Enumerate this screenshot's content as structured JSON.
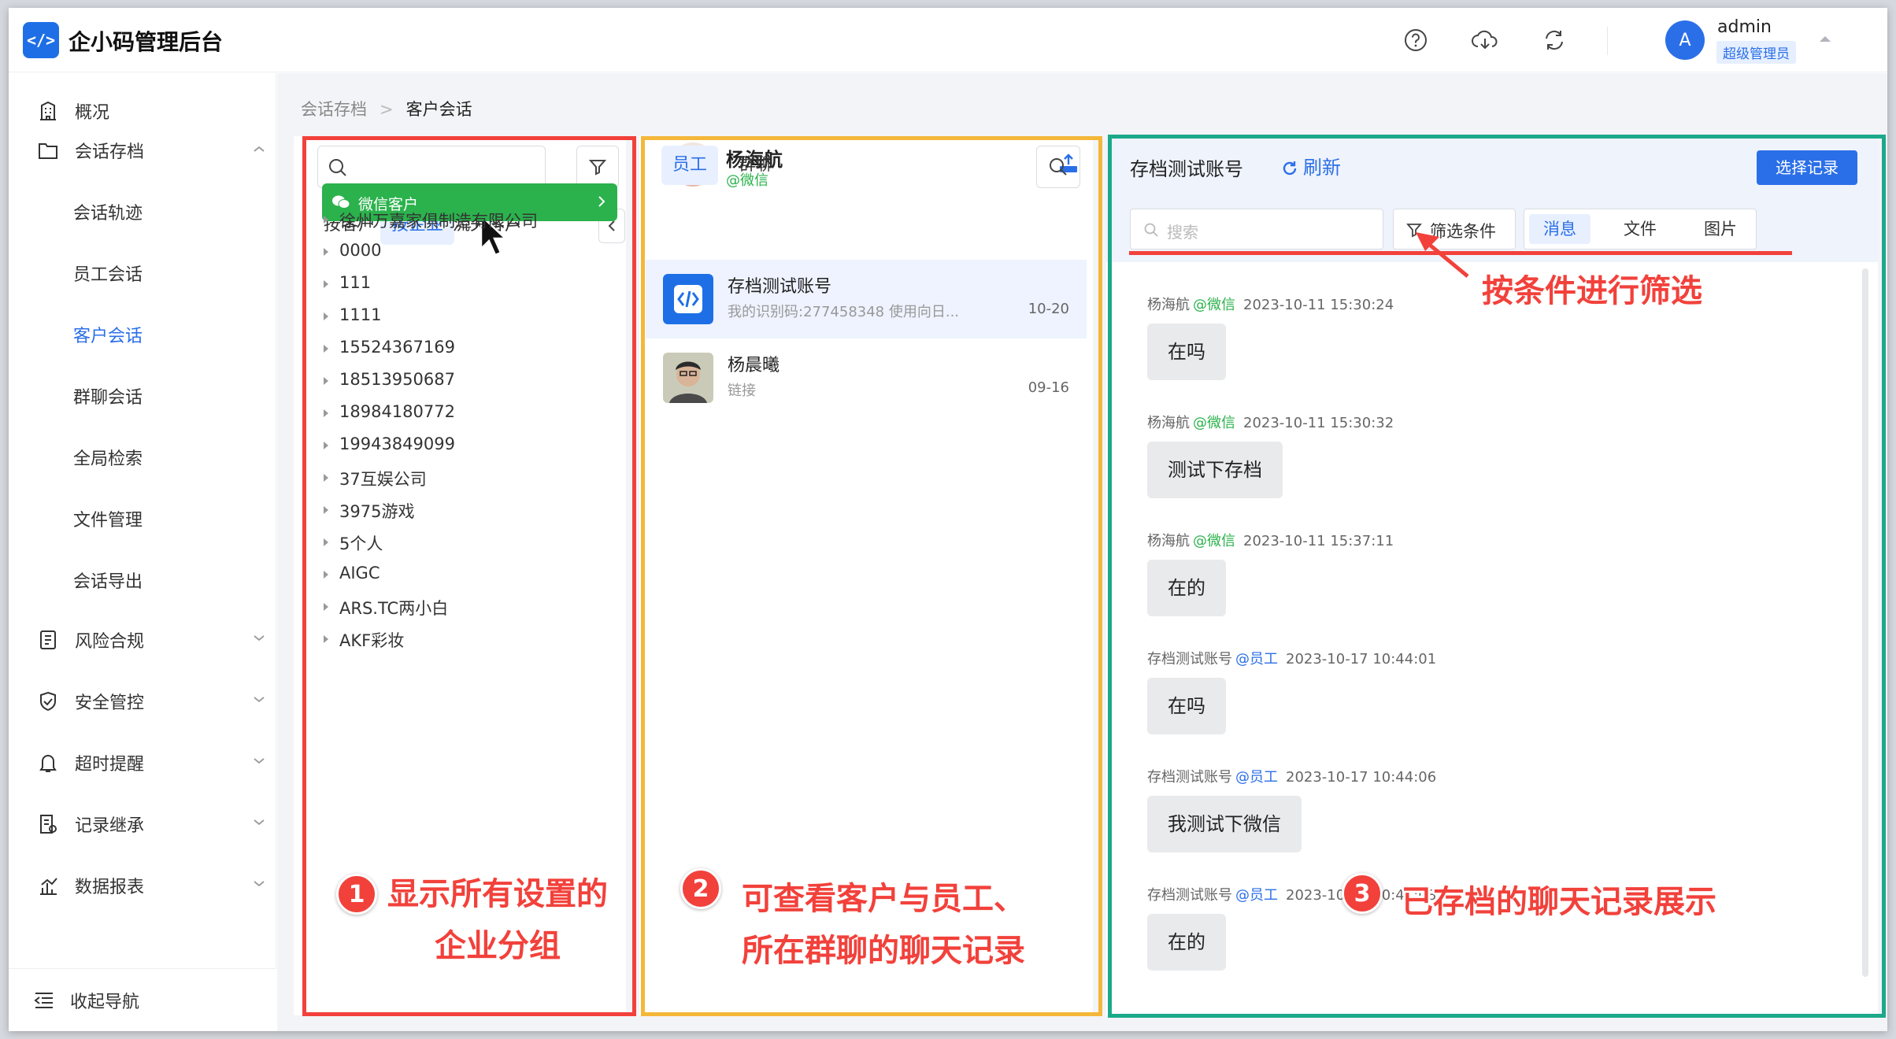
{
  "header": {
    "logo_text": "</>",
    "app_title": "企小码管理后台",
    "user_initial": "A",
    "user_name": "admin",
    "user_role": "超级管理员"
  },
  "sidebar": {
    "items": [
      {
        "label": "概况",
        "icon": "building-icon"
      },
      {
        "label": "会话存档",
        "icon": "folder-icon",
        "expanded": true
      },
      {
        "label": "会话轨迹"
      },
      {
        "label": "员工会话"
      },
      {
        "label": "客户会话",
        "active": true
      },
      {
        "label": "群聊会话"
      },
      {
        "label": "全局检索"
      },
      {
        "label": "文件管理"
      },
      {
        "label": "会话导出"
      },
      {
        "label": "风险合规",
        "icon": "clipboard-icon"
      },
      {
        "label": "安全管控",
        "icon": "shield-check-icon"
      },
      {
        "label": "超时提醒",
        "icon": "bell-icon"
      },
      {
        "label": "记录继承",
        "icon": "record-icon"
      },
      {
        "label": "数据报表",
        "icon": "chart-icon"
      }
    ],
    "collapse_label": "收起导航"
  },
  "breadcrumb": {
    "parent": "会话存档",
    "current": "客户会话"
  },
  "panel1": {
    "tabs": [
      "按客户",
      "按企业",
      "流失客户"
    ],
    "active_tab": "按企业",
    "group_header": "微信客户",
    "groups": [
      "徐州万嘉家俱制造有限公司",
      "0000",
      "111",
      "1111",
      "15524367169",
      "18513950687",
      "18984180772",
      "19943849099",
      "37互娱公司",
      "3975游戏",
      "5个人",
      "AIGC",
      "ARS.TC两小白",
      "AKF彩妆"
    ]
  },
  "panel2": {
    "contact_name": "杨海航",
    "contact_source": "@微信",
    "tabs": [
      "员工",
      "群聊"
    ],
    "active_tab": "员工",
    "conversations": [
      {
        "name": "存档测试账号",
        "preview": "我的识别码:277458348 使用向日...",
        "date": "10-20"
      },
      {
        "name": "杨晨曦",
        "preview": "链接",
        "date": "09-16"
      }
    ]
  },
  "panel3": {
    "title": "存档测试账号",
    "refresh_label": "刷新",
    "select_label": "选择记录",
    "search_placeholder": "搜索",
    "filter_label": "筛选条件",
    "segments": [
      "消息",
      "文件",
      "图片"
    ],
    "active_segment": "消息",
    "messages": [
      {
        "sender": "杨海航",
        "source": "@微信",
        "time": "2023-10-11 15:30:24",
        "text": "在吗"
      },
      {
        "sender": "杨海航",
        "source": "@微信",
        "time": "2023-10-11 15:30:32",
        "text": "测试下存档"
      },
      {
        "sender": "杨海航",
        "source": "@微信",
        "time": "2023-10-11 15:37:11",
        "text": "在的"
      },
      {
        "sender": "存档测试账号",
        "source": "@员工",
        "time": "2023-10-17 10:44:01",
        "text": "在吗"
      },
      {
        "sender": "存档测试账号",
        "source": "@员工",
        "time": "2023-10-17 10:44:06",
        "text": "我测试下微信"
      },
      {
        "sender": "存档测试账号",
        "source": "@员工",
        "time": "2023-10-17 10:44:08",
        "text": "在的"
      }
    ]
  },
  "annotations": {
    "n1": "1",
    "n2": "2",
    "n3": "3",
    "note1_line1": "显示所有设置的",
    "note1_line2": "企业分组",
    "note2_line1": "可查看客户与员工、",
    "note2_line2": "所在群聊的聊天记录",
    "note3": "已存档的聊天记录展示",
    "note_filter": "按条件进行筛选"
  },
  "colors": {
    "accent": "#2b6fe8",
    "wechat": "#2bb24c",
    "annotation": "#f2413b",
    "box1": "#f2413b",
    "box2": "#f4b73a",
    "box3": "#1ba98a"
  }
}
